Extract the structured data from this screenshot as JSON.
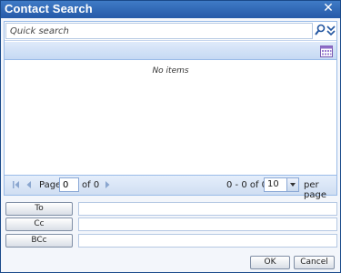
{
  "window": {
    "title": "Contact Search",
    "close_icon": "close-icon"
  },
  "search": {
    "placeholder": "Quick search",
    "value": ""
  },
  "grid": {
    "empty_text": "No items"
  },
  "pager": {
    "page_label": "Page",
    "page_value": "0",
    "of_label": "of 0",
    "range_text": "0 - 0 of 0",
    "page_size": "10",
    "per_page_label": "per page"
  },
  "recipients": [
    {
      "label": "To",
      "value": ""
    },
    {
      "label": "Cc",
      "value": ""
    },
    {
      "label": "BCc",
      "value": ""
    }
  ],
  "footer": {
    "ok_label": "OK",
    "cancel_label": "Cancel"
  },
  "colors": {
    "title_bar": "#2f67b6",
    "border": "#99bbe8",
    "toolbar": "#c5d9f3"
  }
}
